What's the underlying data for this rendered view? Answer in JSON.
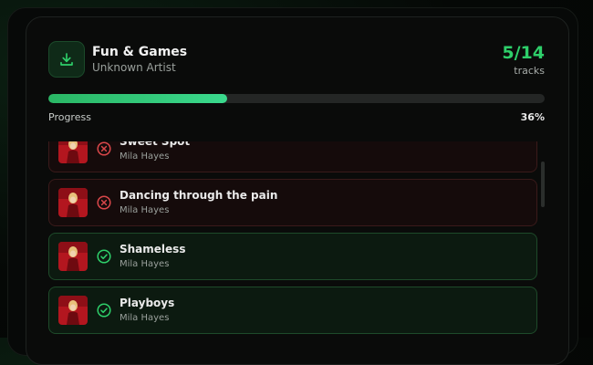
{
  "album": {
    "title": "Fun & Games",
    "artist": "Unknown Artist",
    "count": "5/14",
    "count_label": "tracks",
    "progress_label": "Progress",
    "progress_text": "36%",
    "progress_value": 36
  },
  "tracks": [
    {
      "name": "Sweet Spot",
      "artist": "Mila Hayes",
      "status": "failed"
    },
    {
      "name": "Dancing through the pain",
      "artist": "Mila Hayes",
      "status": "failed"
    },
    {
      "name": "Shameless",
      "artist": "Mila Hayes",
      "status": "done"
    },
    {
      "name": "Playboys",
      "artist": "Mila Hayes",
      "status": "done"
    }
  ],
  "colors": {
    "accent": "#2ecf6a",
    "failed": "#d9474a",
    "success": "#2ecf6a"
  },
  "icons": {
    "download": "download-icon",
    "failed": "x-circle-icon",
    "success": "check-circle-icon"
  }
}
